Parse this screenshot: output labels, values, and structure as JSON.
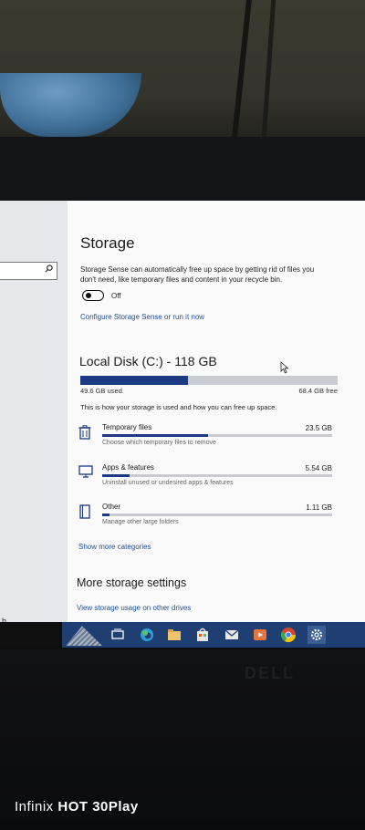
{
  "device": {
    "watermark_brand": "Infinix",
    "watermark_model": "HOT 30Play"
  },
  "left_pane": {
    "search_icon": "search-icon",
    "fragment_text": "h"
  },
  "page": {
    "title": "Storage",
    "sense_description": "Storage Sense can automatically free up space by getting rid of files you don't need, like temporary files and content in your recycle bin.",
    "toggle_label": "Off",
    "toggle_on": false,
    "configure_link": "Configure Storage Sense or run it now"
  },
  "disk": {
    "title": "Local Disk (C:) - 118 GB",
    "used_label": "49.6 GB used",
    "free_label": "68.4 GB free",
    "used_fraction": 0.42,
    "how_text": "This is how your storage is used and how you can free up space."
  },
  "categories": [
    {
      "name": "Temporary files",
      "size": "23.5 GB",
      "desc": "Choose which temporary files to remove",
      "fraction": 0.46,
      "icon": "trash-icon"
    },
    {
      "name": "Apps & features",
      "size": "5.54 GB",
      "desc": "Uninstall unused or undesired apps & features",
      "fraction": 0.12,
      "icon": "monitor-icon"
    },
    {
      "name": "Other",
      "size": "1.11 GB",
      "desc": "Manage other large folders",
      "fraction": 0.03,
      "icon": "folder-icon"
    }
  ],
  "show_more": "Show more categories",
  "more_settings": {
    "title": "More storage settings",
    "view_usage_link": "View storage usage on other drives"
  },
  "taskbar": {
    "icons": [
      "task-view-icon",
      "edge-icon",
      "file-explorer-icon",
      "store-icon",
      "mail-icon",
      "media-player-icon",
      "chrome-icon",
      "settings-icon"
    ],
    "accent": "#1f3f73"
  },
  "colors": {
    "bar_fill": "#1c3a84",
    "bar_bg": "#c9cbd0",
    "link": "#1f4f99"
  }
}
